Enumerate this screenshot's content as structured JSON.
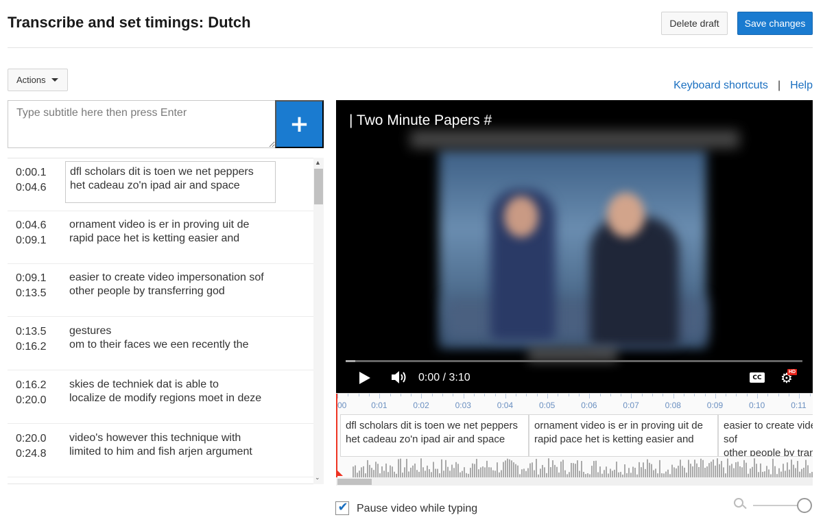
{
  "header": {
    "title": "Transcribe and set timings: Dutch",
    "delete_draft_label": "Delete draft",
    "save_changes_label": "Save changes"
  },
  "toolbar": {
    "actions_label": "Actions",
    "keyboard_shortcuts_label": "Keyboard shortcuts",
    "separator": "|",
    "help_label": "Help"
  },
  "subtitle_input": {
    "placeholder": "Type subtitle here then press Enter",
    "add_label": "+"
  },
  "cues": [
    {
      "start": "0:00.1",
      "end": "0:04.6",
      "line1": "dfl scholars dit is toen we net peppers",
      "line2": "het cadeau zo'n ipad air and space"
    },
    {
      "start": "0:04.6",
      "end": "0:09.1",
      "line1": "ornament video is er in proving uit de",
      "line2": "rapid pace het is ketting easier and"
    },
    {
      "start": "0:09.1",
      "end": "0:13.5",
      "line1": "easier to create video impersonation sof",
      "line2": "other people by transferring god"
    },
    {
      "start": "0:13.5",
      "end": "0:16.2",
      "line1": "gestures",
      "line2": "om to their faces we een recently the"
    },
    {
      "start": "0:16.2",
      "end": "0:20.0",
      "line1": "skies de techniek dat is able to",
      "line2": "localize de modify regions moet in deze"
    },
    {
      "start": "0:20.0",
      "end": "0:24.8",
      "line1": "video's however this technique with",
      "line2": "limited to him and fish arjen argument"
    }
  ],
  "video": {
    "title": "| Two Minute Papers #",
    "time": "0:00 / 3:10",
    "cc_label": "CC",
    "hd_label": "HD",
    "progress": 0.02
  },
  "timeline": {
    "ticks": [
      "00",
      "0:01",
      "0:02",
      "0:03",
      "0:04",
      "0:05",
      "0:06",
      "0:07",
      "0:08",
      "0:09",
      "0:10",
      "0:11"
    ],
    "segments": [
      {
        "line1": "dfl scholars dit is toen we net peppers",
        "line2": "het cadeau zo'n ipad air and space",
        "line3": ""
      },
      {
        "line1": "ornament video is er in proving uit de",
        "line2": "rapid pace het is ketting easier and",
        "line3": ""
      },
      {
        "line1": "easier to create vide",
        "line2": "sof",
        "line3": "other people by tran"
      }
    ]
  },
  "options": {
    "pause_label": "Pause video while typing",
    "pause_checked": true,
    "check_glyph": "✔"
  },
  "colors": {
    "accent": "#1a7bd0",
    "link": "#1a6fc0",
    "playhead": "#e33322"
  }
}
